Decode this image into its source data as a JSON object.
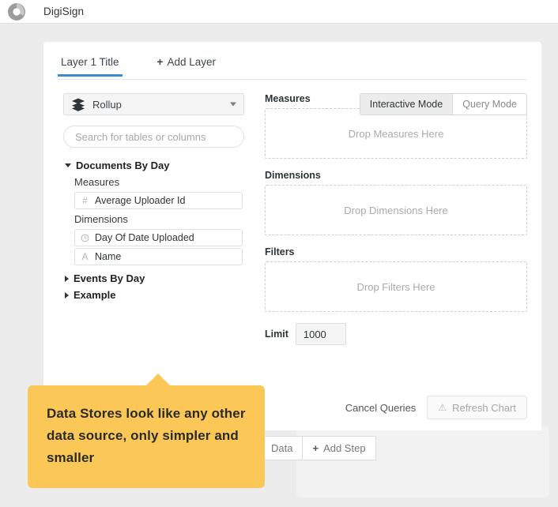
{
  "header": {
    "logo_icon": "donut-logo-icon",
    "title": "DigiSign"
  },
  "tabs": [
    {
      "label": "Layer 1 Title",
      "active": true,
      "icon": null
    },
    {
      "label": "Add Layer",
      "active": false,
      "icon": "plus-icon",
      "plus": "+"
    }
  ],
  "left_panel": {
    "source_select": {
      "icon": "layers-icon",
      "value": "Rollup",
      "caret_icon": "chevron-down-icon"
    },
    "search": {
      "placeholder": "Search for tables or columns",
      "value": ""
    },
    "tree": [
      {
        "name": "Documents By Day",
        "expanded": true,
        "caret_icon": "caret-down-icon",
        "sections": [
          {
            "label": "Measures",
            "fields": [
              {
                "name": "Average Uploader Id",
                "type_icon": "number-icon",
                "type_glyph": "#"
              }
            ]
          },
          {
            "label": "Dimensions",
            "fields": [
              {
                "name": "Day Of Date Uploaded",
                "type_icon": "clock-icon",
                "type_glyph": ""
              },
              {
                "name": "Name",
                "type_icon": "text-icon",
                "type_glyph": "A"
              }
            ]
          }
        ]
      },
      {
        "name": "Events By Day",
        "expanded": false,
        "caret_icon": "caret-right-icon",
        "sections": []
      },
      {
        "name": "Example",
        "expanded": false,
        "caret_icon": "caret-right-icon",
        "sections": []
      }
    ]
  },
  "right_panel": {
    "mode_toggle": [
      {
        "label": "Interactive Mode",
        "active": true
      },
      {
        "label": "Query Mode",
        "active": false
      }
    ],
    "zones": [
      {
        "label": "Measures",
        "placeholder": "Drop Measures Here"
      },
      {
        "label": "Dimensions",
        "placeholder": "Drop Dimensions Here"
      },
      {
        "label": "Filters",
        "placeholder": "Drop Filters Here"
      }
    ],
    "limit": {
      "label": "Limit",
      "value": "1000"
    },
    "actions": {
      "cancel_label": "Cancel Queries",
      "refresh_label": "Refresh Chart",
      "refresh_icon": "warning-triangle-icon",
      "refresh_glyph": "⚠"
    }
  },
  "step_bar": [
    {
      "label": "Data",
      "icon": null,
      "truncated": true
    },
    {
      "label": "Add Step",
      "icon": "plus-icon",
      "plus": "+"
    }
  ],
  "callout": {
    "text": "Data Stores look like any other data source, only simpler and smaller",
    "color": "#fbc858"
  }
}
